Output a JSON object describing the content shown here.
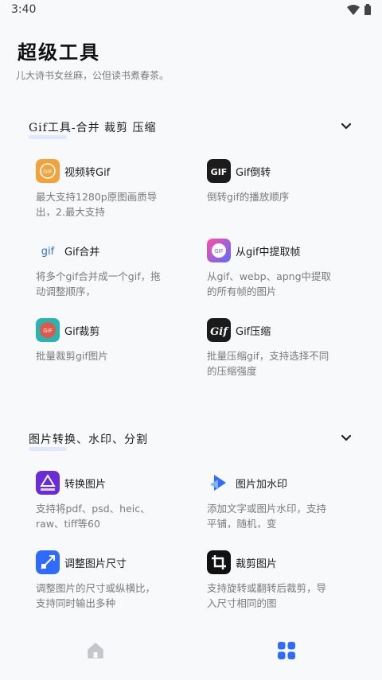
{
  "status": {
    "time": "3:40"
  },
  "header": {
    "title": "超级工具",
    "subtitle": "儿大诗书女丝麻，公但读书煮春茶。"
  },
  "sections": [
    {
      "title": "Gif工具-合并 裁剪 压缩",
      "tools": [
        {
          "name": "视频转Gif",
          "desc": "最大支持1280p原图画质导出，2.最大支持",
          "icon": "video-to-gif-icon"
        },
        {
          "name": "Gif倒转",
          "desc": "倒转gif的播放顺序",
          "icon": "gif-reverse-icon"
        },
        {
          "name": "Gif合并",
          "desc": "将多个gif合并成一个gif，拖动调整顺序，",
          "icon": "gif-merge-icon"
        },
        {
          "name": "从gif中提取帧",
          "desc": "从gif、webp、apng中提取的所有帧的图片",
          "icon": "extract-frames-icon"
        },
        {
          "name": "Gif裁剪",
          "desc": "批量裁剪gif图片",
          "icon": "gif-crop-icon"
        },
        {
          "name": "Gif压缩",
          "desc": "批量压缩gif，支持选择不同的压缩强度",
          "icon": "gif-compress-icon"
        }
      ]
    },
    {
      "title": "图片转换、水印、分割",
      "tools": [
        {
          "name": "转换图片",
          "desc": "支持将pdf、psd、heic、raw、tiff等60",
          "icon": "convert-image-icon"
        },
        {
          "name": "图片加水印",
          "desc": "添加文字或图片水印，支持平铺，随机，变",
          "icon": "watermark-icon"
        },
        {
          "name": "调整图片尺寸",
          "desc": "调整图片的尺寸或纵横比，支持同时输出多种",
          "icon": "resize-image-icon"
        },
        {
          "name": "裁剪图片",
          "desc": "支持旋转或翻转后裁剪，导入尺寸相同的图",
          "icon": "crop-image-icon"
        }
      ]
    }
  ],
  "nav": {
    "home": "home-icon",
    "apps": "apps-grid-icon"
  },
  "colors": {
    "accent": "#2f6bff",
    "inactive": "#c4c6cc"
  }
}
